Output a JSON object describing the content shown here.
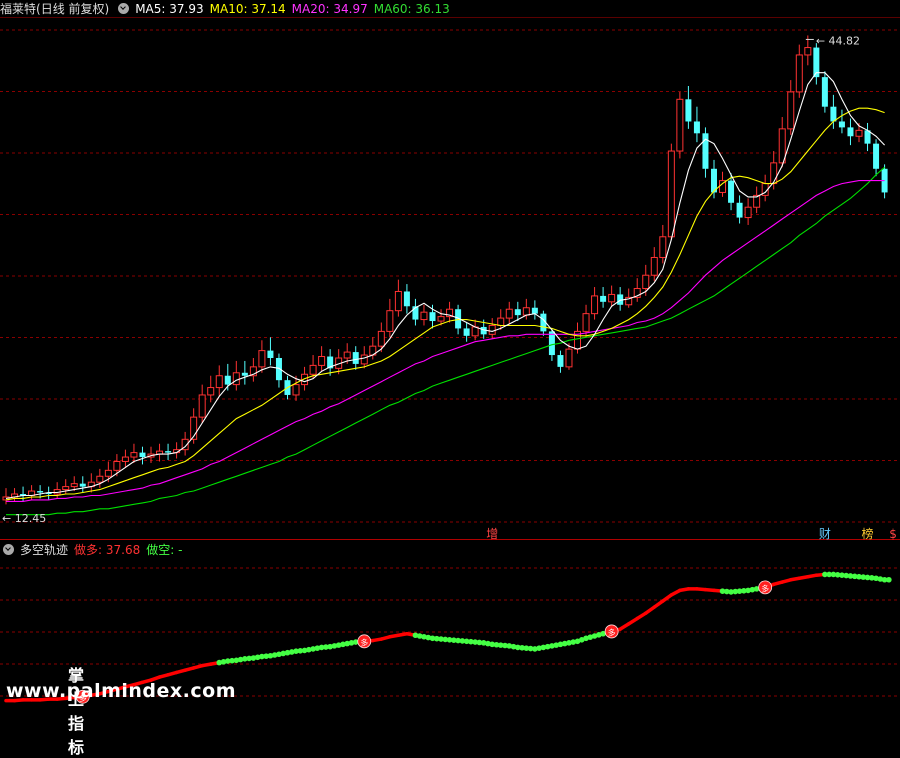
{
  "header": {
    "stock_name": "福莱特",
    "mode": "(日线 前复权)",
    "ma5_label": "MA5: 37.93",
    "ma10_label": "MA10: 37.14",
    "ma20_label": "MA20: 34.97",
    "ma60_label": "MA60: 36.13"
  },
  "colors": {
    "up": "#ff3232",
    "down": "#54ffff",
    "ma5": "#ffffff",
    "ma10": "#ffff00",
    "ma20": "#ff00ff",
    "ma60": "#00e000",
    "grid": "#8a0000",
    "bull": "#ff0000",
    "bear": "#44ff44"
  },
  "sub_header": {
    "indicator_name": "多空轨迹",
    "long_label": "做多: 37.68",
    "short_label": "做空: -"
  },
  "price_markers": {
    "high_label": "44.82",
    "low_label": "12.45"
  },
  "event_markers": [
    {
      "text": "增",
      "bar": 57
    },
    {
      "text": "财",
      "bar": 96
    },
    {
      "text": "榜",
      "bar": 101
    },
    {
      "text": "$",
      "bar": 104
    }
  ],
  "signal_marker": "多",
  "watermark": {
    "line1": "掌上指标",
    "line2": "www.palmindex.com"
  },
  "chart_data": {
    "type": "candlestick",
    "y_range": [
      11.5,
      46
    ],
    "high": 44.82,
    "low": 12.45,
    "candles": [
      [
        13.4,
        13.6,
        14.2,
        13.1
      ],
      [
        13.6,
        13.8,
        14.2,
        13.3
      ],
      [
        13.8,
        13.7,
        14.3,
        13.3
      ],
      [
        13.7,
        14.0,
        14.4,
        13.4
      ],
      [
        14.0,
        13.9,
        14.4,
        13.5
      ],
      [
        13.9,
        13.8,
        14.3,
        13.4
      ],
      [
        13.8,
        14.1,
        14.6,
        13.5
      ],
      [
        14.1,
        14.3,
        14.8,
        13.8
      ],
      [
        14.3,
        14.5,
        15.0,
        14.0
      ],
      [
        14.5,
        14.3,
        15.0,
        13.9
      ],
      [
        14.3,
        14.6,
        15.2,
        13.9
      ],
      [
        14.6,
        15.0,
        15.5,
        14.2
      ],
      [
        15.0,
        15.4,
        16.0,
        14.6
      ],
      [
        15.4,
        16.0,
        16.5,
        15.0
      ],
      [
        16.0,
        16.3,
        16.8,
        15.6
      ],
      [
        16.3,
        16.6,
        17.2,
        15.9
      ],
      [
        16.6,
        16.3,
        17.0,
        15.8
      ],
      [
        16.3,
        16.5,
        17.0,
        15.9
      ],
      [
        16.5,
        16.7,
        17.2,
        16.0
      ],
      [
        16.7,
        16.6,
        17.2,
        16.1
      ],
      [
        16.6,
        16.8,
        17.3,
        16.2
      ],
      [
        16.8,
        17.5,
        18.0,
        16.4
      ],
      [
        17.5,
        19.0,
        19.6,
        17.2
      ],
      [
        19.0,
        20.5,
        21.2,
        18.6
      ],
      [
        20.5,
        21.0,
        21.8,
        20.0
      ],
      [
        21.0,
        21.8,
        22.5,
        20.4
      ],
      [
        21.8,
        21.2,
        22.6,
        20.8
      ],
      [
        21.2,
        22.0,
        22.8,
        20.8
      ],
      [
        22.0,
        21.8,
        22.8,
        21.2
      ],
      [
        21.8,
        22.4,
        23.0,
        21.4
      ],
      [
        22.4,
        23.5,
        24.2,
        22.0
      ],
      [
        23.5,
        23.0,
        24.4,
        22.5
      ],
      [
        23.0,
        21.5,
        23.3,
        21.0
      ],
      [
        21.5,
        20.5,
        21.8,
        20.2
      ],
      [
        20.5,
        21.2,
        21.8,
        20.1
      ],
      [
        21.2,
        21.9,
        22.4,
        20.8
      ],
      [
        21.9,
        22.5,
        23.2,
        21.6
      ],
      [
        22.5,
        23.1,
        23.8,
        22.1
      ],
      [
        23.1,
        22.3,
        23.6,
        21.8
      ],
      [
        22.3,
        23.0,
        23.6,
        21.9
      ],
      [
        23.0,
        23.4,
        24.0,
        22.6
      ],
      [
        23.4,
        22.6,
        23.8,
        22.2
      ],
      [
        22.6,
        23.2,
        23.8,
        22.3
      ],
      [
        23.2,
        23.8,
        24.4,
        22.9
      ],
      [
        23.8,
        24.8,
        25.4,
        23.4
      ],
      [
        24.8,
        26.2,
        27.0,
        24.4
      ],
      [
        26.2,
        27.5,
        28.3,
        25.8
      ],
      [
        27.5,
        26.5,
        28.0,
        26.0
      ],
      [
        26.5,
        25.6,
        27.0,
        25.2
      ],
      [
        25.6,
        26.1,
        26.6,
        25.2
      ],
      [
        26.1,
        25.5,
        26.6,
        25.0
      ],
      [
        25.5,
        25.8,
        26.3,
        25.2
      ],
      [
        25.8,
        26.3,
        26.8,
        25.4
      ],
      [
        26.3,
        25.0,
        26.6,
        24.6
      ],
      [
        25.0,
        24.5,
        25.4,
        24.1
      ],
      [
        24.5,
        25.1,
        25.6,
        24.2
      ],
      [
        25.1,
        24.6,
        25.6,
        24.3
      ],
      [
        24.6,
        25.2,
        25.7,
        24.3
      ],
      [
        25.2,
        25.7,
        26.3,
        24.9
      ],
      [
        25.7,
        26.3,
        26.8,
        25.3
      ],
      [
        26.3,
        25.9,
        26.8,
        25.5
      ],
      [
        25.9,
        26.4,
        27.0,
        25.6
      ],
      [
        26.4,
        26.0,
        26.9,
        25.6
      ],
      [
        26.0,
        24.8,
        26.2,
        24.5
      ],
      [
        24.8,
        23.2,
        25.0,
        22.8
      ],
      [
        23.2,
        22.4,
        23.5,
        22.0
      ],
      [
        22.4,
        23.6,
        24.0,
        22.2
      ],
      [
        23.6,
        24.8,
        25.4,
        23.3
      ],
      [
        24.8,
        26.0,
        26.6,
        24.4
      ],
      [
        26.0,
        27.2,
        27.8,
        25.6
      ],
      [
        27.2,
        26.8,
        27.8,
        26.4
      ],
      [
        26.8,
        27.3,
        27.9,
        26.5
      ],
      [
        27.3,
        26.6,
        27.8,
        26.2
      ],
      [
        26.6,
        27.1,
        27.7,
        26.4
      ],
      [
        27.1,
        27.7,
        28.4,
        26.8
      ],
      [
        27.7,
        28.6,
        29.3,
        27.2
      ],
      [
        28.6,
        29.8,
        30.5,
        28.2
      ],
      [
        29.8,
        31.2,
        32.0,
        29.4
      ],
      [
        31.2,
        37.0,
        37.5,
        31.0
      ],
      [
        37.0,
        40.5,
        41.0,
        36.5
      ],
      [
        40.5,
        39.0,
        41.4,
        38.5
      ],
      [
        39.0,
        38.2,
        40.0,
        37.6
      ],
      [
        38.2,
        35.8,
        38.6,
        35.2
      ],
      [
        35.8,
        34.2,
        36.4,
        33.8
      ],
      [
        34.2,
        35.0,
        35.6,
        33.9
      ],
      [
        35.0,
        33.5,
        35.5,
        33.0
      ],
      [
        33.5,
        32.5,
        34.0,
        32.1
      ],
      [
        32.5,
        33.2,
        33.8,
        32.0
      ],
      [
        33.2,
        34.0,
        34.6,
        32.8
      ],
      [
        34.0,
        34.8,
        35.4,
        33.6
      ],
      [
        34.8,
        36.2,
        37.0,
        34.4
      ],
      [
        36.2,
        38.5,
        39.3,
        35.9
      ],
      [
        38.5,
        41.0,
        41.8,
        38.1
      ],
      [
        41.0,
        43.5,
        44.2,
        40.6
      ],
      [
        43.5,
        44.0,
        44.82,
        42.8
      ],
      [
        44.0,
        42.0,
        44.3,
        41.5
      ],
      [
        42.0,
        40.0,
        42.4,
        39.6
      ],
      [
        40.0,
        39.0,
        40.8,
        38.5
      ],
      [
        39.0,
        38.6,
        39.8,
        38.2
      ],
      [
        38.6,
        38.0,
        39.2,
        37.4
      ],
      [
        38.0,
        38.4,
        38.9,
        37.6
      ],
      [
        38.4,
        37.5,
        38.9,
        37.0
      ],
      [
        37.5,
        35.8,
        37.8,
        35.3
      ],
      [
        35.8,
        34.2,
        36.1,
        33.8
      ]
    ],
    "ma5": [
      13.5,
      13.6,
      13.7,
      13.7,
      13.8,
      13.9,
      13.9,
      14.0,
      14.1,
      14.2,
      14.3,
      14.5,
      14.8,
      15.2,
      15.6,
      16.0,
      16.2,
      16.4,
      16.5,
      16.5,
      16.6,
      17.0,
      17.7,
      18.6,
      19.5,
      20.4,
      21.1,
      21.5,
      21.7,
      21.9,
      22.2,
      22.4,
      22.3,
      21.9,
      21.6,
      21.4,
      21.6,
      22.1,
      22.4,
      22.6,
      22.8,
      22.9,
      23.0,
      23.2,
      23.6,
      24.3,
      25.2,
      25.9,
      26.4,
      26.7,
      26.3,
      26.0,
      25.9,
      25.7,
      25.4,
      25.1,
      24.9,
      24.8,
      25.0,
      25.3,
      25.6,
      25.9,
      26.0,
      25.6,
      24.9,
      24.2,
      23.8,
      23.6,
      23.8,
      24.6,
      25.6,
      26.5,
      26.9,
      27.0,
      27.2,
      27.5,
      28.1,
      29.0,
      31.0,
      33.5,
      35.7,
      37.2,
      37.8,
      37.5,
      36.5,
      35.4,
      34.3,
      33.9,
      33.9,
      34.2,
      34.9,
      36.0,
      37.8,
      39.7,
      41.5,
      42.3,
      42.3,
      41.7,
      40.5,
      39.4,
      38.7,
      38.4,
      38.0,
      37.4
    ],
    "ma10": [
      13.4,
      13.5,
      13.5,
      13.6,
      13.6,
      13.7,
      13.7,
      13.8,
      13.8,
      13.9,
      14.0,
      14.1,
      14.3,
      14.5,
      14.7,
      14.9,
      15.1,
      15.3,
      15.5,
      15.6,
      15.8,
      16.0,
      16.4,
      16.9,
      17.4,
      17.9,
      18.4,
      18.9,
      19.2,
      19.5,
      19.8,
      20.2,
      20.6,
      21.0,
      21.3,
      21.6,
      21.8,
      21.9,
      22.0,
      22.1,
      22.2,
      22.3,
      22.4,
      22.6,
      22.8,
      23.1,
      23.5,
      23.9,
      24.3,
      24.7,
      25.1,
      25.3,
      25.5,
      25.6,
      25.6,
      25.5,
      25.4,
      25.3,
      25.2,
      25.2,
      25.2,
      25.2,
      25.2,
      25.1,
      25.0,
      24.8,
      24.6,
      24.5,
      24.5,
      24.6,
      24.8,
      25.0,
      25.3,
      25.6,
      26.0,
      26.5,
      27.1,
      27.8,
      28.8,
      30.0,
      31.3,
      32.6,
      33.6,
      34.3,
      34.8,
      35.2,
      35.3,
      35.2,
      35.0,
      34.8,
      34.8,
      35.1,
      35.6,
      36.3,
      37.0,
      37.7,
      38.4,
      39.0,
      39.4,
      39.7,
      39.9,
      39.9,
      39.8,
      39.6
    ],
    "ma20": [
      13.3,
      13.3,
      13.3,
      13.4,
      13.4,
      13.4,
      13.5,
      13.5,
      13.6,
      13.6,
      13.7,
      13.7,
      13.8,
      13.9,
      14.0,
      14.1,
      14.2,
      14.4,
      14.5,
      14.7,
      14.9,
      15.1,
      15.3,
      15.5,
      15.8,
      16.0,
      16.3,
      16.6,
      16.9,
      17.2,
      17.5,
      17.8,
      18.1,
      18.4,
      18.7,
      18.9,
      19.2,
      19.4,
      19.7,
      19.9,
      20.2,
      20.5,
      20.8,
      21.1,
      21.4,
      21.7,
      22.0,
      22.3,
      22.6,
      22.8,
      23.1,
      23.3,
      23.5,
      23.7,
      23.9,
      24.1,
      24.2,
      24.3,
      24.4,
      24.5,
      24.5,
      24.6,
      24.6,
      24.6,
      24.6,
      24.6,
      24.6,
      24.6,
      24.7,
      24.8,
      24.9,
      25.0,
      25.1,
      25.2,
      25.4,
      25.5,
      25.7,
      26.0,
      26.4,
      26.9,
      27.4,
      28.0,
      28.6,
      29.1,
      29.6,
      30.0,
      30.4,
      30.8,
      31.2,
      31.6,
      32.0,
      32.4,
      32.8,
      33.2,
      33.6,
      34.0,
      34.3,
      34.6,
      34.8,
      34.9,
      35.0,
      35.0,
      35.0,
      35.0
    ],
    "ma60": [
      12.4,
      12.4,
      12.4,
      12.4,
      12.4,
      12.4,
      12.5,
      12.5,
      12.6,
      12.6,
      12.7,
      12.8,
      12.8,
      12.9,
      13.0,
      13.1,
      13.2,
      13.3,
      13.5,
      13.6,
      13.7,
      13.9,
      14.0,
      14.2,
      14.4,
      14.6,
      14.8,
      15.0,
      15.2,
      15.4,
      15.6,
      15.8,
      16.0,
      16.3,
      16.5,
      16.8,
      17.1,
      17.4,
      17.7,
      18.0,
      18.3,
      18.6,
      18.9,
      19.2,
      19.5,
      19.8,
      20.0,
      20.3,
      20.6,
      20.8,
      21.1,
      21.3,
      21.5,
      21.7,
      21.9,
      22.1,
      22.3,
      22.5,
      22.7,
      22.9,
      23.1,
      23.3,
      23.5,
      23.7,
      23.9,
      24.0,
      24.2,
      24.3,
      24.4,
      24.5,
      24.6,
      24.7,
      24.8,
      24.9,
      25.0,
      25.1,
      25.3,
      25.5,
      25.7,
      26.0,
      26.3,
      26.6,
      26.9,
      27.2,
      27.6,
      28.0,
      28.4,
      28.8,
      29.2,
      29.6,
      30.0,
      30.4,
      30.8,
      31.3,
      31.7,
      32.1,
      32.6,
      33.0,
      33.4,
      33.8,
      34.3,
      34.8,
      35.4,
      35.9
    ],
    "trend": [
      12.5,
      12.5,
      12.6,
      12.6,
      12.6,
      12.7,
      12.7,
      12.8,
      12.9,
      13.0,
      13.2,
      13.4,
      13.7,
      14.0,
      14.3,
      14.6,
      14.9,
      15.2,
      15.6,
      15.9,
      16.2,
      16.5,
      16.8,
      17.1,
      17.3,
      17.5,
      17.7,
      17.8,
      18.0,
      18.1,
      18.3,
      18.4,
      18.6,
      18.8,
      19.0,
      19.1,
      19.3,
      19.5,
      19.6,
      19.8,
      20.0,
      20.2,
      20.3,
      20.4,
      20.6,
      20.9,
      21.1,
      21.3,
      21.1,
      20.9,
      20.7,
      20.6,
      20.5,
      20.4,
      20.3,
      20.2,
      20.1,
      19.9,
      19.8,
      19.7,
      19.5,
      19.4,
      19.3,
      19.5,
      19.7,
      19.9,
      20.1,
      20.3,
      20.7,
      21.0,
      21.3,
      21.6,
      21.9,
      22.6,
      23.3,
      24.0,
      24.8,
      25.6,
      26.4,
      27.0,
      27.2,
      27.2,
      27.1,
      27.0,
      26.9,
      26.8,
      26.9,
      27.0,
      27.2,
      27.4,
      27.8,
      28.1,
      28.4,
      28.6,
      28.8,
      29.0,
      29.1,
      29.1,
      29.0,
      28.9,
      28.8,
      28.7,
      28.6,
      28.4
    ],
    "trend_state": [
      "bull",
      "bull",
      "bull",
      "bull",
      "bull",
      "bull",
      "bull",
      "bull",
      "bull",
      "bull",
      "bull",
      "bull",
      "bull",
      "bull",
      "bull",
      "bull",
      "bull",
      "bull",
      "bull",
      "bull",
      "bull",
      "bull",
      "bull",
      "bull",
      "bull",
      "bear",
      "bear",
      "bear",
      "bear",
      "bear",
      "bear",
      "bear",
      "bear",
      "bear",
      "bear",
      "bear",
      "bear",
      "bear",
      "bear",
      "bear",
      "bear",
      "bear",
      "bull",
      "bull",
      "bull",
      "bull",
      "bull",
      "bull",
      "bear",
      "bear",
      "bear",
      "bear",
      "bear",
      "bear",
      "bear",
      "bear",
      "bear",
      "bear",
      "bear",
      "bear",
      "bear",
      "bear",
      "bear",
      "bear",
      "bear",
      "bear",
      "bear",
      "bear",
      "bear",
      "bear",
      "bear",
      "bull",
      "bull",
      "bull",
      "bull",
      "bull",
      "bull",
      "bull",
      "bull",
      "bull",
      "bull",
      "bull",
      "bull",
      "bull",
      "bear",
      "bear",
      "bear",
      "bear",
      "bear",
      "bull",
      "bull",
      "bull",
      "bull",
      "bull",
      "bull",
      "bull",
      "bear",
      "bear",
      "bear",
      "bear",
      "bear",
      "bear",
      "bear",
      "bear",
      "bear"
    ],
    "signals": [
      9,
      42,
      71,
      89
    ]
  }
}
